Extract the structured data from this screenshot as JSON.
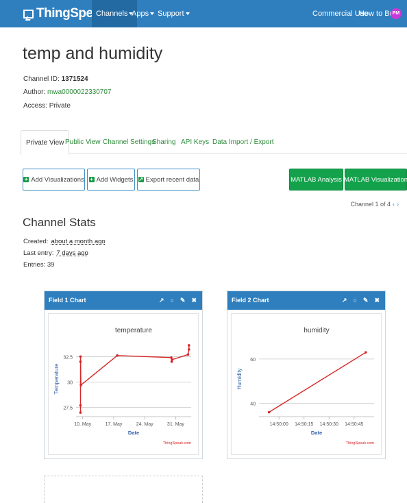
{
  "nav": {
    "brand": "ThingSpeak",
    "brand_tm": "™",
    "channels": "Channels",
    "apps": "Apps",
    "support": "Support",
    "commercial": "Commercial Use",
    "how_to_buy": "How to Buy",
    "avatar": "PM"
  },
  "channel": {
    "title": "temp and humidity",
    "id_label": "Channel ID:",
    "id_value": "1371524",
    "author_label": "Author:",
    "author_value": "mwa0000022330707",
    "access_label": "Access:",
    "access_value": "Private"
  },
  "tabs": [
    "Private View",
    "Public View",
    "Channel Settings",
    "Sharing",
    "API Keys",
    "Data Import / Export"
  ],
  "buttons": {
    "add_vis": "Add Visualizations",
    "add_widgets": "Add Widgets",
    "export": "Export recent data",
    "matlab_analysis": "MATLAB Analysis",
    "matlab_vis": "MATLAB Visualization"
  },
  "pager": {
    "text": "Channel 1 of 4",
    "prev": "‹",
    "next": "›"
  },
  "stats": {
    "title": "Channel Stats",
    "created_label": "Created:",
    "created_value": "about a month ago",
    "last_label": "Last entry:",
    "last_value": "7 days ago",
    "entries_label": "Entries:",
    "entries_value": "39"
  },
  "colors": {
    "nav": "#2f7fbf",
    "link": "#2e8b3b",
    "series": "#d62728",
    "button_green": "#13a14b"
  },
  "widgets": [
    {
      "title": "Field 1 Chart",
      "icons": [
        "external-link-icon",
        "comment-icon",
        "pencil-icon",
        "close-icon"
      ]
    },
    {
      "title": "Field 2 Chart",
      "icons": [
        "external-link-icon",
        "comment-icon",
        "pencil-icon",
        "close-icon"
      ]
    }
  ],
  "chart_data": [
    {
      "type": "line",
      "title": "temperature",
      "xlabel": "Date",
      "ylabel": "Temperature",
      "credit": "ThingSpeak.com",
      "x_ticks": [
        "10. May",
        "17. May",
        "24. May",
        "31. May"
      ],
      "x_range": [
        8.5,
        34.5
      ],
      "y_ticks": [
        "27.5",
        "30",
        "32.5"
      ],
      "ylim": [
        26.6,
        34.0
      ],
      "grid": true,
      "series": [
        {
          "x": [
            9.5,
            9.5,
            9.5,
            9.5,
            9.6,
            17.8,
            30.0,
            30.1,
            30.2,
            33.8,
            34.0,
            34.0
          ],
          "values": [
            27.0,
            27.7,
            32.0,
            32.5,
            29.7,
            32.6,
            32.4,
            32.0,
            32.2,
            32.7,
            33.2,
            33.6
          ]
        }
      ]
    },
    {
      "type": "line",
      "title": "humidity",
      "xlabel": "Date",
      "ylabel": "Humidity",
      "credit": "ThingSpeak.com",
      "x_ticks": [
        "14:50:00",
        "14:50:15",
        "14:50:30",
        "14:50:45"
      ],
      "x_range": [
        -12,
        57
      ],
      "y_ticks": [
        "40",
        "60"
      ],
      "ylim": [
        34,
        68
      ],
      "grid": true,
      "series": [
        {
          "x": [
            -6,
            52
          ],
          "values": [
            36,
            63
          ]
        }
      ]
    }
  ]
}
